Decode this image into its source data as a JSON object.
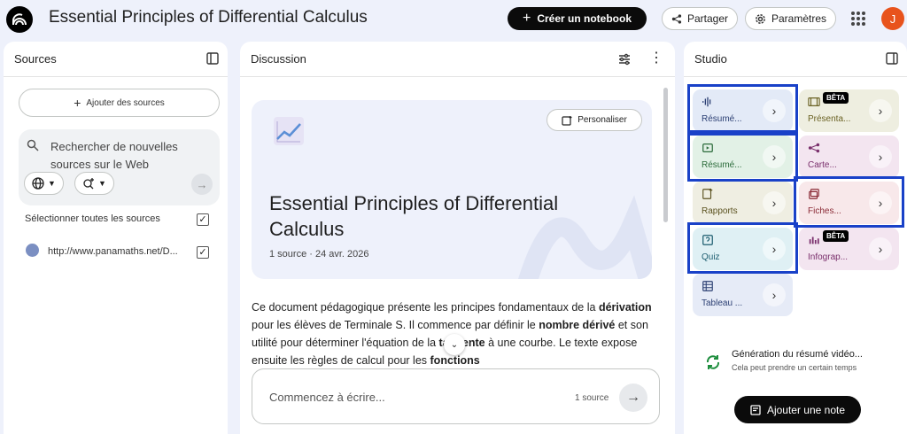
{
  "header": {
    "title": "Essential Principles of Differential Calculus",
    "create_label": "Créer un notebook",
    "share_label": "Partager",
    "settings_label": "Paramètres",
    "avatar_initial": "J"
  },
  "sources": {
    "title": "Sources",
    "add_label": "Ajouter des sources",
    "search_placeholder": "Rechercher de nouvelles sources sur le Web",
    "select_all_label": "Sélectionner toutes les sources",
    "items": [
      {
        "label": "http://www.panamaths.net/D...",
        "checked": true
      }
    ]
  },
  "discussion": {
    "title": "Discussion",
    "personalize_label": "Personaliser",
    "notebook_title": "Essential Principles of Differential Calculus",
    "meta": "1 source · 24 avr. 2026",
    "summary_segments": [
      {
        "text": "Ce document pédagogique présente les principes fondamentaux de la ",
        "bold": false
      },
      {
        "text": "dérivation",
        "bold": true
      },
      {
        "text": " pour les élèves de Terminale S. Il commence par définir le ",
        "bold": false
      },
      {
        "text": "nombre dérivé",
        "bold": true
      },
      {
        "text": " et son utilité pour déterminer l'équation de la ",
        "bold": false
      },
      {
        "text": "tangente",
        "bold": true
      },
      {
        "text": " à une courbe. Le texte expose ensuite les règles de calcul pour les ",
        "bold": false
      },
      {
        "text": "fonctions",
        "bold": true
      }
    ],
    "input_placeholder": "Commencez à écrire...",
    "source_count": "1 source"
  },
  "studio": {
    "title": "Studio",
    "tiles": [
      {
        "label": "Résumé...",
        "icon": "audio-wave-icon",
        "color": "#e3eaf7",
        "text_color": "#2b3f73",
        "highlighted": true
      },
      {
        "label": "Présenta...",
        "icon": "slides-icon",
        "color": "#eeeee0",
        "text_color": "#6b6224",
        "badge": "BÊTA"
      },
      {
        "label": "Résumé...",
        "icon": "video-icon",
        "color": "#e2f1e6",
        "text_color": "#2b6b3a",
        "highlighted": true
      },
      {
        "label": "Carte...",
        "icon": "mindmap-icon",
        "color": "#f3e5f0",
        "text_color": "#7a2f6c"
      },
      {
        "label": "Rapports",
        "icon": "report-icon",
        "color": "#efeee2",
        "text_color": "#5b5220"
      },
      {
        "label": "Fiches...",
        "icon": "flashcards-icon",
        "color": "#f8e8ea",
        "text_color": "#8a2b36",
        "highlighted": true
      },
      {
        "label": "Quiz",
        "icon": "quiz-icon",
        "color": "#dff0f4",
        "text_color": "#1e5e70",
        "highlighted": true
      },
      {
        "label": "Infograp...",
        "icon": "infographic-icon",
        "color": "#f3e5f0",
        "text_color": "#7a2f6c",
        "badge": "BÊTA"
      },
      {
        "label": "Tableau ...",
        "icon": "table-icon",
        "color": "#e6ebf7",
        "text_color": "#2b3f73"
      }
    ],
    "generation_title": "Génération du résumé vidéo...",
    "generation_subtitle": "Cela peut prendre un certain temps",
    "add_note_label": "Ajouter une note"
  }
}
